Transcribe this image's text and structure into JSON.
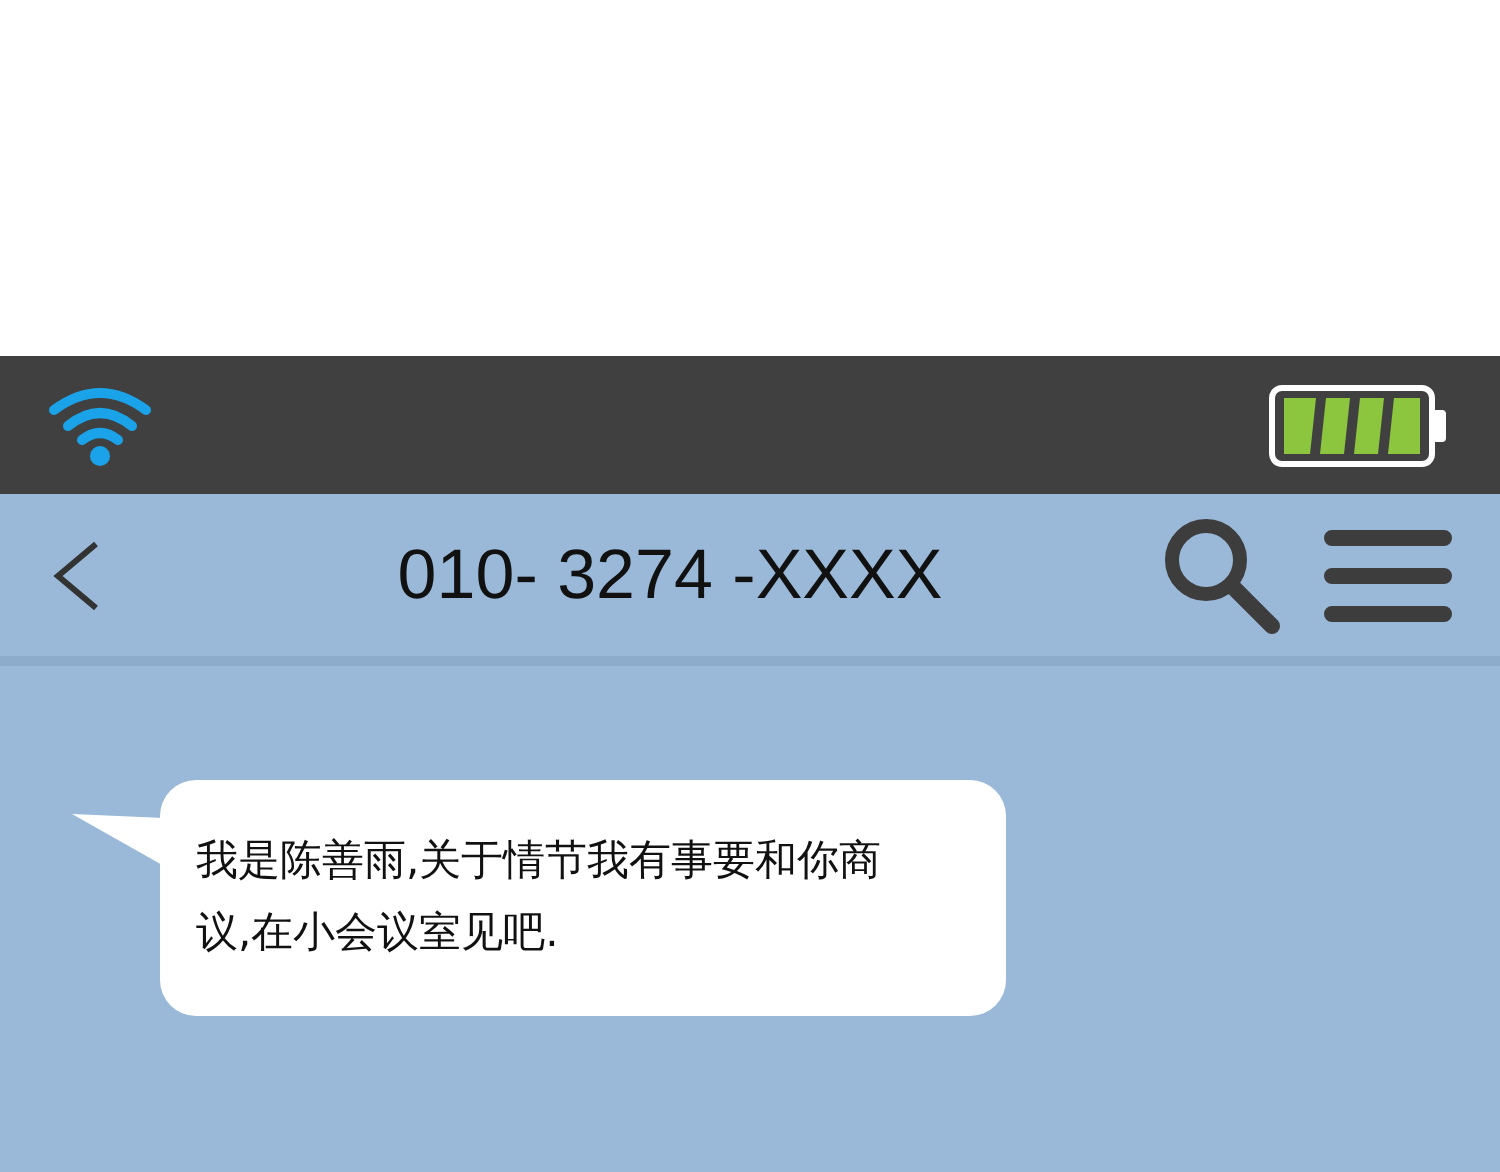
{
  "header": {
    "title": "010- 3274 -XXXX"
  },
  "messages": [
    {
      "kind": "incoming",
      "text": "我是陈善雨,关于情节我有事要和你商议,在小会议室见吧."
    }
  ]
}
